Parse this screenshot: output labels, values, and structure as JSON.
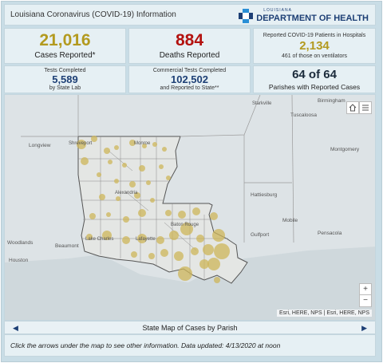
{
  "header": {
    "title": "Louisiana Coronavirus (COVID-19) Information",
    "logo_top": "LOUISIANA",
    "logo_main": "DEPARTMENT OF HEALTH"
  },
  "stats": {
    "cases": {
      "value": "21,016",
      "label": "Cases Reported*"
    },
    "deaths": {
      "value": "884",
      "label": "Deaths Reported"
    },
    "hospital": {
      "caption": "Reported COVID-19 Patients in Hospitals",
      "value": "2,134",
      "sub": "461 of those on ventilators"
    },
    "state_tests": {
      "caption": "Tests Completed",
      "value": "5,589",
      "sub": "by State Lab"
    },
    "commercial_tests": {
      "caption": "Commercial Tests Completed",
      "value": "102,502",
      "sub": "and Reported to State**"
    },
    "parishes": {
      "value": "64 of 64",
      "label": "Parishes with Reported Cases"
    }
  },
  "colors": {
    "cases": "#b39a1f",
    "deaths": "#b3120f",
    "navy": "#1d3f75",
    "bubble": "#cdb65a"
  },
  "map": {
    "cities": {
      "Starkville": "Starkville",
      "Birmingham": "Birmingham",
      "Tuscaloosa": "Tuscaloosa",
      "Longview": "Longview",
      "Shreveport": "Shreveport",
      "Montgomery": "Montgomery",
      "Monroe": "Monroe",
      "Alexandria": "Alexandria",
      "Hattiesburg": "Hattiesburg",
      "Mobile": "Mobile",
      "Pensacola": "Pensacola",
      "Beaumont": "Beaumont",
      "Woodlands": "Woodlands",
      "Houston": "Houston",
      "Lake Charles": "Lake Charles",
      "Lafayette": "Lafayette",
      "Baton Rouge": "Baton Rouge",
      "Gulfport": "Gulfport"
    },
    "attribution": "Esri, HERE, NPS | Esri, HERE, NPS",
    "zoom_in": "+",
    "zoom_out": "−"
  },
  "nav": {
    "caption": "State Map of Cases by Parish",
    "prev": "◀",
    "next": "▶"
  },
  "footer": {
    "text": "Click the arrows under the map to see other information. Data updated: 4/13/2020 at noon"
  }
}
